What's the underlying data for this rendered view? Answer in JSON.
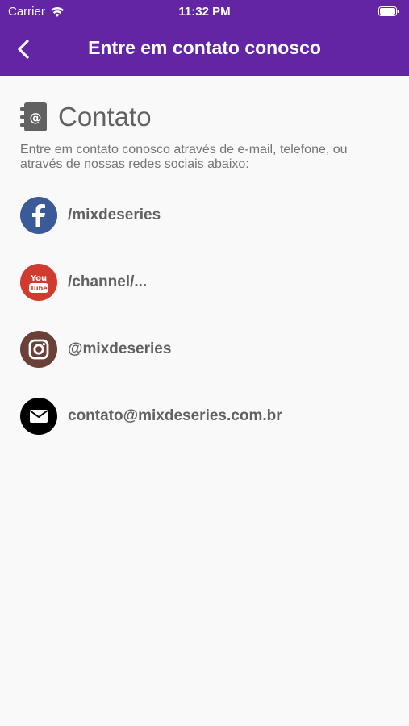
{
  "status_bar": {
    "carrier": "Carrier",
    "time": "11:32 PM"
  },
  "navbar": {
    "title": "Entre em contato conosco",
    "back_icon": "chevron-left-icon"
  },
  "section": {
    "title": "Contato",
    "description": "Entre em contato conosco através de e-mail, telefone, ou através de nossas redes sociais abaixo:"
  },
  "contacts": [
    {
      "label": "/mixdeseries",
      "icon": "facebook-icon",
      "color": "#3a5a98"
    },
    {
      "label": "/channel/...",
      "icon": "youtube-icon",
      "color": "#d13b2f"
    },
    {
      "label": "@mixdeseries",
      "icon": "instagram-icon",
      "color": "#6b4036"
    },
    {
      "label": "contato@mixdeseries.com.br",
      "icon": "email-icon",
      "color": "#000000"
    }
  ],
  "colors": {
    "header": "#6325a4",
    "background": "#f9f9f9",
    "text": "#616161"
  }
}
